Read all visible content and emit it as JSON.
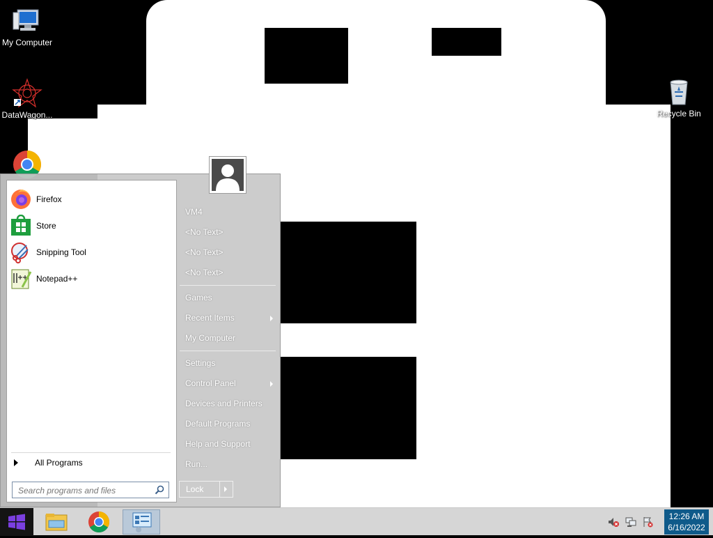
{
  "desktop": {
    "icons": [
      {
        "label": "My Computer",
        "icon": "my-computer-icon"
      },
      {
        "label": "DataWagon...",
        "icon": "datawagon-icon"
      },
      {
        "label": "Recycle Bin",
        "icon": "recycle-bin-icon"
      },
      {
        "label": "",
        "icon": "chrome-icon"
      }
    ]
  },
  "start_menu": {
    "pinned": [
      {
        "label": "Firefox",
        "icon": "firefox-icon"
      },
      {
        "label": "Store",
        "icon": "store-icon"
      },
      {
        "label": "Snipping Tool",
        "icon": "snipping-tool-icon"
      },
      {
        "label": "Notepad++",
        "icon": "notepad-plus-plus-icon"
      }
    ],
    "all_programs": "All Programs",
    "search_placeholder": "Search programs and files",
    "right_items": [
      {
        "label": "VM4",
        "submenu": false
      },
      {
        "label": "<No Text>",
        "submenu": false
      },
      {
        "label": "<No Text>",
        "submenu": false
      },
      {
        "label": "<No Text>",
        "submenu": false
      },
      {
        "label": "Games",
        "submenu": false
      },
      {
        "label": "Recent Items",
        "submenu": true
      },
      {
        "label": "My Computer",
        "submenu": false
      },
      {
        "label": "Settings",
        "submenu": false
      },
      {
        "label": "Control Panel",
        "submenu": true
      },
      {
        "label": "Devices and Printers",
        "submenu": false
      },
      {
        "label": "Default Programs",
        "submenu": false
      },
      {
        "label": "Help and Support",
        "submenu": false
      },
      {
        "label": "Run...",
        "submenu": false
      }
    ],
    "lock_label": "Lock"
  },
  "taskbar": {
    "pinned": [
      "windows-start-icon",
      "file-explorer-icon",
      "chrome-icon",
      "control-panel-icon"
    ],
    "tray": [
      "volume-muted-icon",
      "network-icon",
      "action-center-icon"
    ],
    "time": "12:26 AM",
    "date": "6/16/2022"
  }
}
